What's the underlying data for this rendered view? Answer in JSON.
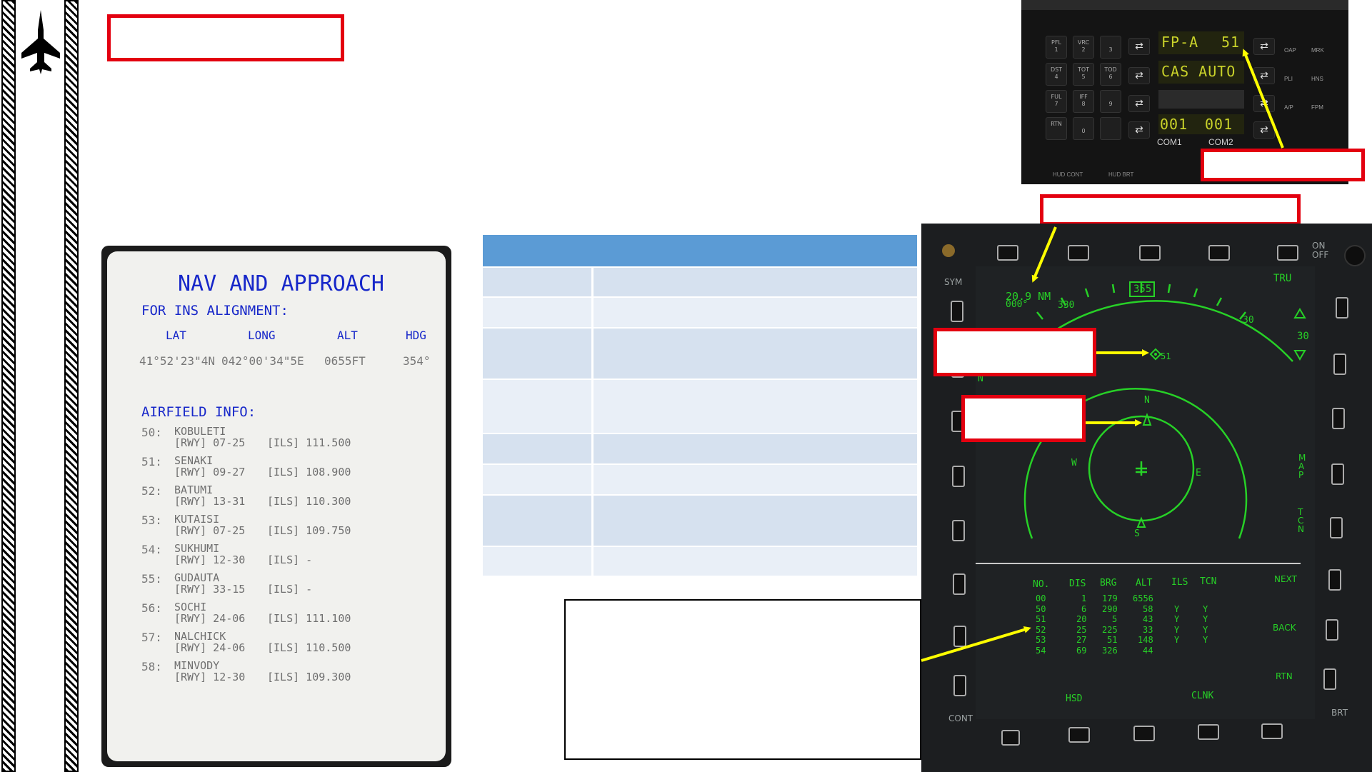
{
  "kneeboard": {
    "title": "NAV AND APPROACH",
    "ins_heading": "FOR INS ALIGNMENT:",
    "columns": [
      "LAT",
      "LONG",
      "ALT",
      "HDG"
    ],
    "alignment": {
      "lat": "41°52'23\"4N",
      "long": "042°00'34\"5E",
      "alt": "0655FT",
      "hdg": "354°"
    },
    "airfield_heading": "AIRFIELD INFO:",
    "airfields": [
      {
        "num": "50:",
        "name": "KOBULETI",
        "rwy": "[RWY] 07-25",
        "ils": "[ILS] 111.500"
      },
      {
        "num": "51:",
        "name": "SENAKI",
        "rwy": "[RWY] 09-27",
        "ils": "[ILS] 108.900"
      },
      {
        "num": "52:",
        "name": "BATUMI",
        "rwy": "[RWY] 13-31",
        "ils": "[ILS] 110.300"
      },
      {
        "num": "53:",
        "name": "KUTAISI",
        "rwy": "[RWY] 07-25",
        "ils": "[ILS] 109.750"
      },
      {
        "num": "54:",
        "name": "SUKHUMI",
        "rwy": "[RWY] 12-30",
        "ils": "[ILS] -"
      },
      {
        "num": "55:",
        "name": "GUDAUTA",
        "rwy": "[RWY] 33-15",
        "ils": "[ILS] -"
      },
      {
        "num": "56:",
        "name": "SOCHI",
        "rwy": "[RWY] 24-06",
        "ils": "[ILS] 111.100"
      },
      {
        "num": "57:",
        "name": "NALCHICK",
        "rwy": "[RWY] 24-06",
        "ils": "[ILS] 110.500"
      },
      {
        "num": "58:",
        "name": "MINVODY",
        "rwy": "[RWY] 12-30",
        "ils": "[ILS] 109.300"
      }
    ]
  },
  "ufc": {
    "line1_mode": "FP-A",
    "line1_value": "51",
    "line2": "CAS AUTO",
    "com1_value": "001",
    "com2_value": "001",
    "com1_label": "COM1",
    "com2_label": "COM2",
    "keys": [
      {
        "label": "PFL",
        "num": "1"
      },
      {
        "label": "VRC",
        "num": "2"
      },
      {
        "label": "",
        "num": "3"
      },
      {
        "label": "DST",
        "num": "4"
      },
      {
        "label": "TOT",
        "num": "5"
      },
      {
        "label": "TOD",
        "num": "6"
      },
      {
        "label": "FUL",
        "num": "7"
      },
      {
        "label": "IFF",
        "num": "8"
      },
      {
        "label": "",
        "num": "9"
      },
      {
        "label": "RTN",
        "num": ""
      },
      {
        "label": "",
        "num": "0"
      },
      {
        "label": "",
        "num": ""
      }
    ],
    "right_labels": [
      "OAP",
      "MRK",
      "PLI",
      "HNS",
      "A/P",
      "FPM"
    ],
    "bottom_labels": [
      "HUD CONT",
      "HUD BRT"
    ]
  },
  "mfd": {
    "range_nm": "20.9 NM",
    "bearing": "000°",
    "heading_box": "355",
    "tru": "TRU",
    "sym": "SYM",
    "on_off": "ON\nOFF",
    "scale_30": "30",
    "ticks": {
      "left": "330",
      "right": "30"
    },
    "compass": {
      "n": "N",
      "s": "S",
      "e": "E",
      "w": "W",
      "outer_n": "N"
    },
    "waypoint_label": "51",
    "side_labels": {
      "map": "M\nA\nP",
      "tcn": "T\nC\nN",
      "next": "NEXT",
      "back": "BACK",
      "rtn": "RTN",
      "brt": "BRT",
      "cont": "CONT"
    },
    "bottom_labels": {
      "hsd": "HSD",
      "clnk": "CLNK"
    },
    "table": {
      "headers": [
        "NO.",
        "DIS",
        "BRG",
        "ALT",
        "ILS",
        "TCN"
      ],
      "rows": [
        [
          "00",
          "1",
          "179",
          "6556",
          "",
          ""
        ],
        [
          "50",
          "6",
          "290",
          "58",
          "Y",
          "Y"
        ],
        [
          "51",
          "20",
          "5",
          "43",
          "Y",
          "Y"
        ],
        [
          "52",
          "25",
          "225",
          "33",
          "Y",
          "Y"
        ],
        [
          "53",
          "27",
          "51",
          "148",
          "Y",
          "Y"
        ],
        [
          "54",
          "69",
          "326",
          "44",
          "",
          ""
        ]
      ]
    }
  },
  "colors": {
    "accent_red": "#e3000f",
    "table_header": "#5b9bd5",
    "table_row_dark": "#d6e1ef",
    "table_row_light": "#e9eff7",
    "mfd_green": "#27d127",
    "ufc_lcd": "#c9d22a",
    "arrow_yellow": "#ffff00"
  }
}
